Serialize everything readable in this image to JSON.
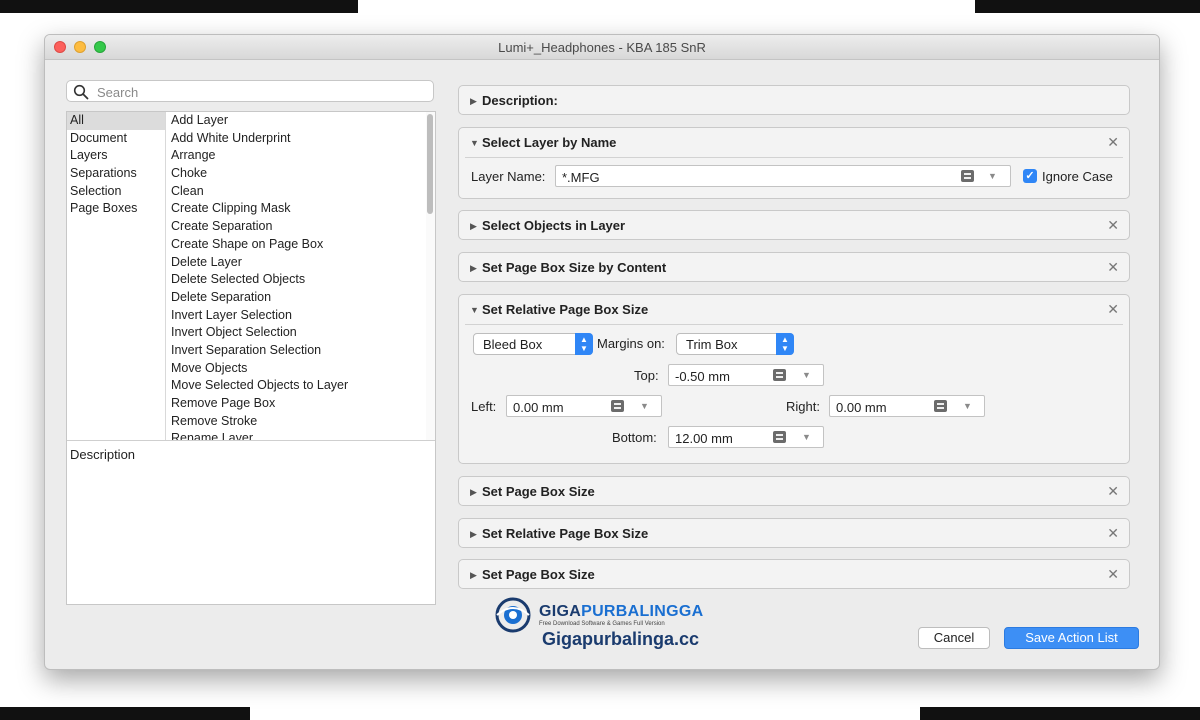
{
  "window": {
    "title": "Lumi+_Headphones - KBA 185 SnR"
  },
  "search": {
    "placeholder": "Search"
  },
  "categories": [
    "All",
    "Document",
    "Layers",
    "Separations",
    "Selection",
    "Page Boxes"
  ],
  "actions": [
    "Add Layer",
    "Add White Underprint",
    "Arrange",
    "Choke",
    "Clean",
    "Create Clipping Mask",
    "Create Separation",
    "Create Shape on Page Box",
    "Delete Layer",
    "Delete Selected Objects",
    "Delete Separation",
    "Invert Layer Selection",
    "Invert Object Selection",
    "Invert Separation Selection",
    "Move Objects",
    "Move Selected Objects to Layer",
    "Remove Page Box",
    "Remove Stroke",
    "Rename Layer"
  ],
  "left_description_label": "Description",
  "sections": {
    "description": {
      "title": "Description:"
    },
    "select_layer": {
      "title": "Select Layer by Name",
      "layer_name_label": "Layer Name:",
      "layer_name_value": "*.MFG",
      "ignore_case_label": "Ignore Case"
    },
    "select_objects": {
      "title": "Select Objects in Layer"
    },
    "page_box_content": {
      "title": "Set Page Box Size by Content"
    },
    "relative_box": {
      "title": "Set Relative Page Box Size",
      "box_value": "Bleed Box",
      "margins_label": "Margins on:",
      "margins_value": "Trim Box",
      "top_label": "Top:",
      "top_value": "-0.50 mm",
      "left_label": "Left:",
      "left_value": "0.00 mm",
      "right_label": "Right:",
      "right_value": "0.00 mm",
      "bottom_label": "Bottom:",
      "bottom_value": "12.00 mm"
    },
    "page_box_1": {
      "title": "Set Page Box Size"
    },
    "relative_box_2": {
      "title": "Set Relative Page Box Size"
    },
    "page_box_2": {
      "title": "Set Page Box Size"
    }
  },
  "buttons": {
    "cancel": "Cancel",
    "save": "Save Action List"
  },
  "watermark": {
    "brand_1": "GIGA",
    "brand_2": "PURBALINGGA",
    "tagline": "Free Download Software & Games Full Version",
    "url": "Gigapurbalinga.cc"
  },
  "colors": {
    "accent": "#2f86f6",
    "save_button": "#3d8ff5",
    "close_red": "#fc605c",
    "min_yellow": "#fdbc40",
    "max_green": "#34c84a"
  }
}
